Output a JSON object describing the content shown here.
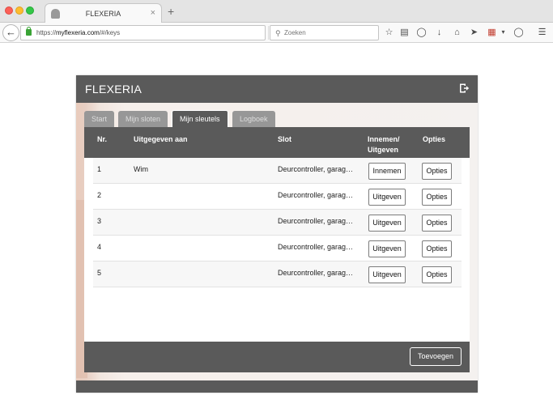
{
  "browser": {
    "tab_title": "FLEXERIA",
    "url_prefix": "https://",
    "url_domain": "myflexeria.com",
    "url_path": "/#/keys",
    "search_placeholder": "Zoeken"
  },
  "app": {
    "title": "FLEXERIA",
    "tabs": [
      {
        "label": "Start",
        "state": "inactive"
      },
      {
        "label": "Mijn sloten",
        "state": "inactive"
      },
      {
        "label": "Mijn sleutels",
        "state": "active"
      },
      {
        "label": "Logboek",
        "state": "inactive"
      }
    ],
    "table": {
      "headers": {
        "nr": "Nr.",
        "issued_to": "Uitgegeven aan",
        "slot": "Slot",
        "action_line1": "Innemen/",
        "action_line2": "Uitgeven",
        "options": "Opties"
      },
      "rows": [
        {
          "nr": "1",
          "issued_to": "Wim",
          "slot": "Deurcontroller, garag…",
          "action": "Innemen",
          "options": "Opties"
        },
        {
          "nr": "2",
          "issued_to": "",
          "slot": "Deurcontroller, garag…",
          "action": "Uitgeven",
          "options": "Opties"
        },
        {
          "nr": "3",
          "issued_to": "",
          "slot": "Deurcontroller, garag…",
          "action": "Uitgeven",
          "options": "Opties"
        },
        {
          "nr": "4",
          "issued_to": "",
          "slot": "Deurcontroller, garag…",
          "action": "Uitgeven",
          "options": "Opties"
        },
        {
          "nr": "5",
          "issued_to": "",
          "slot": "Deurcontroller, garag…",
          "action": "Uitgeven",
          "options": "Opties"
        }
      ]
    },
    "add_button": "Toevoegen"
  },
  "colors": {
    "header_gray": "#5a5a5a",
    "tab_inactive": "#979797",
    "lock_green": "#3aa335"
  }
}
